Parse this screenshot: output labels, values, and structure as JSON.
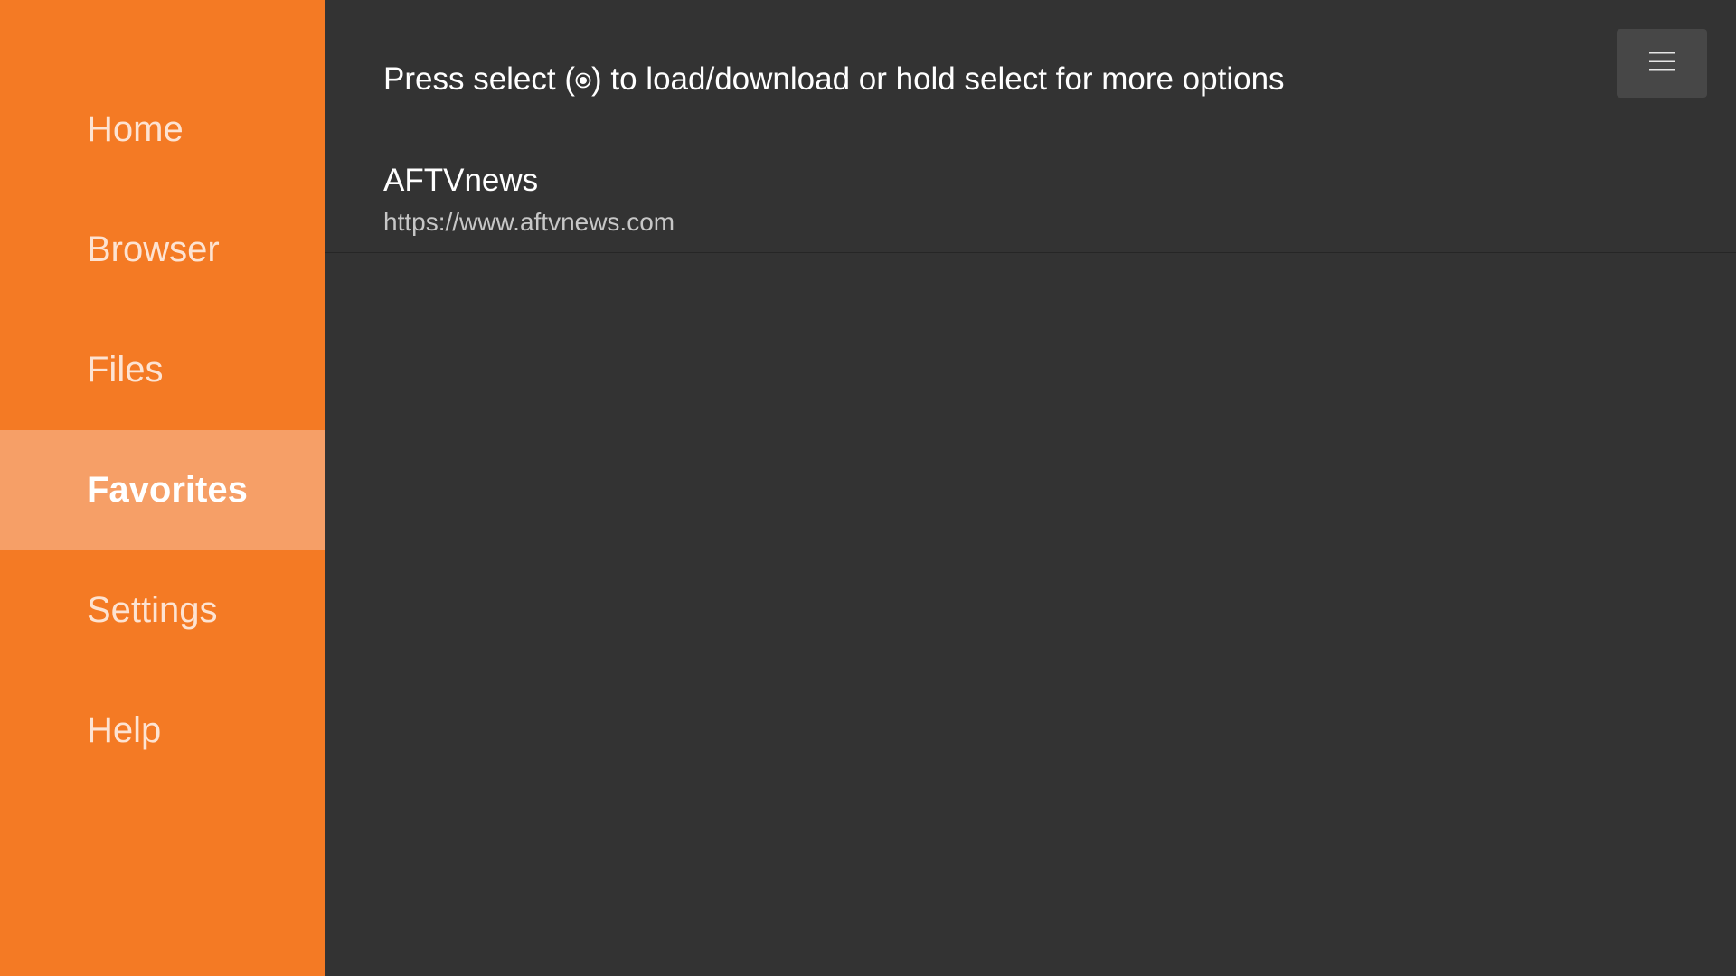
{
  "sidebar": {
    "items": [
      {
        "label": "Home",
        "active": false
      },
      {
        "label": "Browser",
        "active": false
      },
      {
        "label": "Files",
        "active": false
      },
      {
        "label": "Favorites",
        "active": true
      },
      {
        "label": "Settings",
        "active": false
      },
      {
        "label": "Help",
        "active": false
      }
    ]
  },
  "main": {
    "hint_prefix": "Press select (",
    "hint_icon": "select-button-icon",
    "hint_suffix": ") to load/download or hold select for more options",
    "menu_icon": "hamburger-menu-icon",
    "favorites": [
      {
        "title": "AFTVnews",
        "url": "https://www.aftvnews.com"
      }
    ]
  },
  "colors": {
    "sidebar_bg": "#F47A24",
    "sidebar_active_bg": "#F69F67",
    "main_bg": "#333333",
    "menu_button_bg": "#474747"
  }
}
